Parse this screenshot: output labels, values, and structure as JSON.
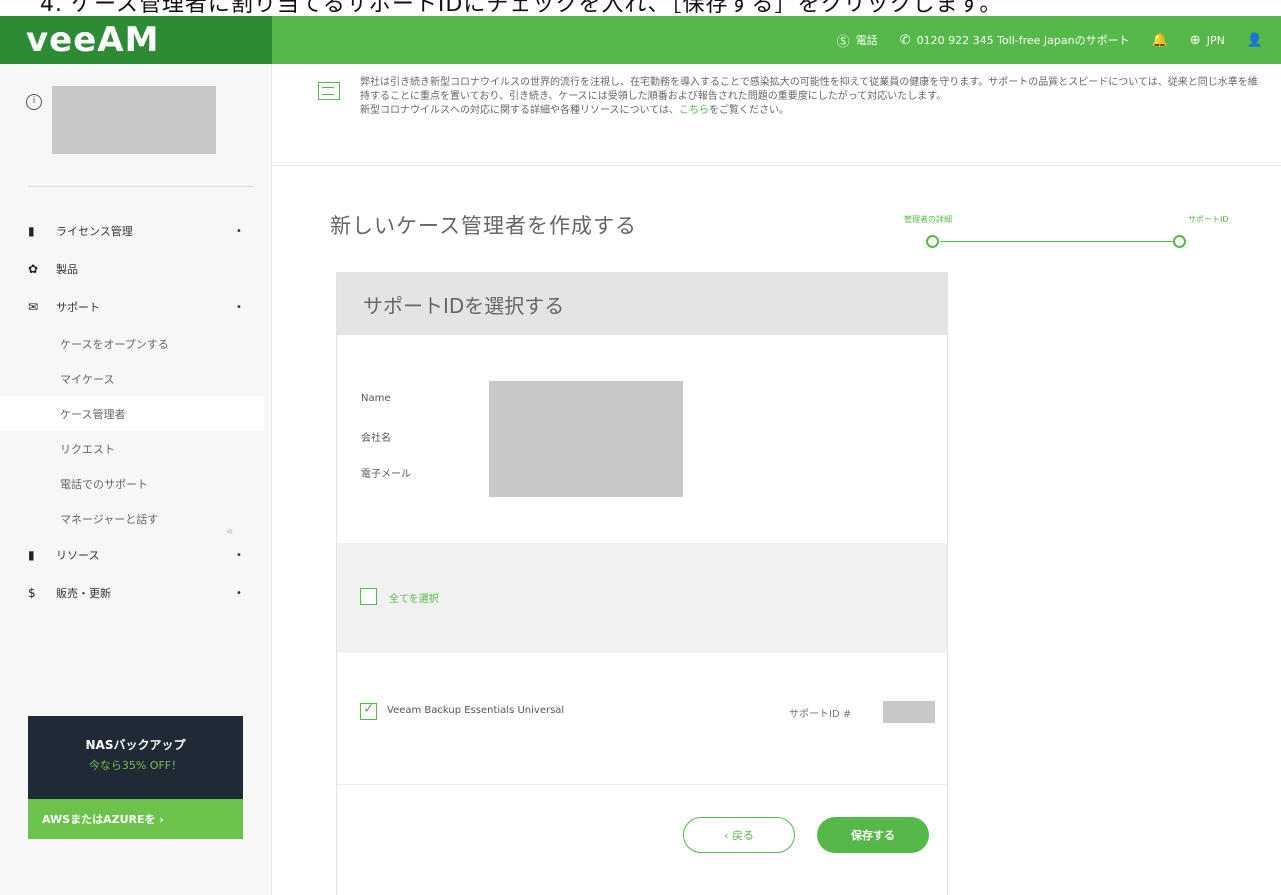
{
  "caption": {
    "text": "4. ケース管理者に割り当てるサポートIDにチェックを入れ、［保存する］をクリックします。"
  },
  "header": {
    "logo": "veeAM",
    "items": [
      {
        "icon": "chat-icon",
        "glyph": "Ⓢ",
        "label": "電話"
      },
      {
        "icon": "phone-icon",
        "glyph": "✆",
        "label": "0120 922 345  Toll-free Japanのサポート"
      },
      {
        "icon": "bell-icon",
        "glyph": "🔔",
        "label": ""
      },
      {
        "icon": "globe-icon",
        "glyph": "⊕",
        "label": "JPN"
      },
      {
        "icon": "user-icon",
        "glyph": "👤",
        "label": ""
      }
    ]
  },
  "sidebar": {
    "nav": [
      {
        "name": "licenses",
        "icon": "document-icon",
        "glyph": "▮",
        "label": "ライセンス管理",
        "caret": "•"
      },
      {
        "name": "products",
        "icon": "products-icon",
        "glyph": "✿",
        "label": "製品",
        "caret": ""
      },
      {
        "name": "support",
        "icon": "support-icon",
        "glyph": "✉",
        "label": "サポート",
        "caret": "•"
      }
    ],
    "support_sub": [
      {
        "label": "ケースをオープンする",
        "active": false
      },
      {
        "label": "マイケース",
        "active": false
      },
      {
        "label": "ケース管理者",
        "active": true
      },
      {
        "label": "リクエスト",
        "active": false
      },
      {
        "label": "電話でのサポート",
        "active": false
      },
      {
        "label": "マネージャーと話す",
        "active": false
      }
    ],
    "nav_bottom": [
      {
        "name": "resources",
        "icon": "resources-icon",
        "glyph": "▮",
        "label": "リソース",
        "caret": "•"
      },
      {
        "name": "sales",
        "icon": "dollar-icon",
        "glyph": "$",
        "label": "販売・更新",
        "caret": "•"
      }
    ],
    "collapse_glyph": "«",
    "promo": {
      "line1": "NASバックアップ",
      "line2": "今なら35% OFF！",
      "button": "AWSまたはAZUREを ›"
    }
  },
  "notice": {
    "text": "弊社は引き続き新型コロナウイルスの世界的流行を注視し、在宅勤務を導入することで感染拡大の可能性を抑えて従業員の健康を守ります。サポートの品質とスピードについては、従来と同じ水準を維持することに重点を置いており、引き続き、ケースには受領した順番および報告された問題の重要度にしたがって対応いたします。",
    "line2_pre": "新型コロナウイルスへの対応に関する詳細や各種リソースについては、",
    "line2_link": "こちら",
    "line2_post": "をご覧ください。"
  },
  "page": {
    "title": "新しいケース管理者を作成する",
    "steps": [
      "管理者の詳細",
      "サポートID"
    ]
  },
  "panel": {
    "heading": "サポートIDを選択する",
    "fields": [
      "Name",
      "会社名",
      "電子メール"
    ],
    "select_all": "全てを選択",
    "license": {
      "name": "Veeam Backup Essentials Universal",
      "id_label": "サポートID #",
      "checked": true
    },
    "back_button": "‹ 戻る",
    "save_button": "保存する"
  }
}
